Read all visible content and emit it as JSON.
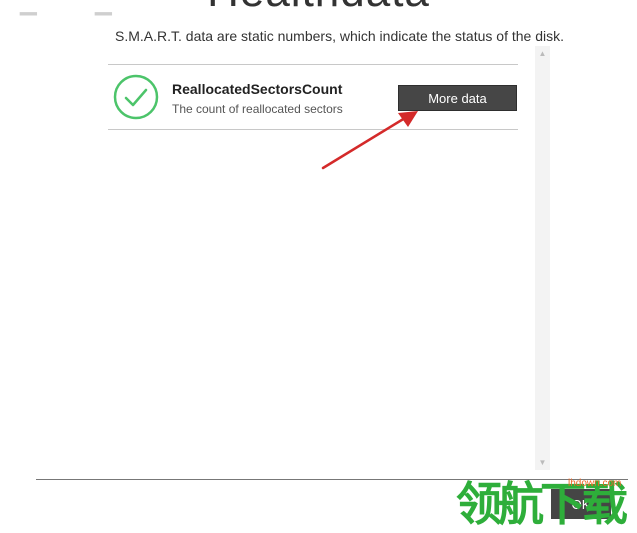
{
  "dialog": {
    "title": "Healthdata",
    "subtitle": "S.M.A.R.T. data are static numbers, which indicate the status of the disk."
  },
  "items": [
    {
      "name": "ReallocatedSectorsCount",
      "description": "The count of reallocated sectors",
      "status_icon": "check-circle-icon",
      "button_label": "More data"
    }
  ],
  "footer": {
    "ok_label": "OK"
  },
  "watermark": {
    "chars": "领航下载",
    "url": "lhdown.com"
  },
  "colors": {
    "check_green": "#4cc46a",
    "button_bg": "#464646",
    "annotation_arrow": "#d42a2a",
    "watermark_green": "#2eae3a"
  }
}
